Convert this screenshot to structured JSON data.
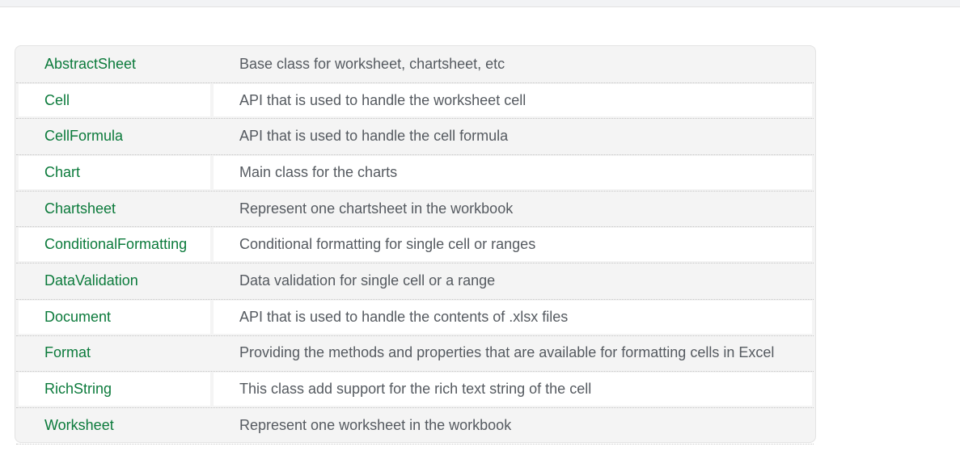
{
  "classes": [
    {
      "name": "AbstractSheet",
      "description": "Base class for worksheet, chartsheet, etc"
    },
    {
      "name": "Cell",
      "description": "API that is used to handle the worksheet cell"
    },
    {
      "name": "CellFormula",
      "description": "API that is used to handle the cell formula"
    },
    {
      "name": "Chart",
      "description": "Main class for the charts"
    },
    {
      "name": "Chartsheet",
      "description": "Represent one chartsheet in the workbook"
    },
    {
      "name": "ConditionalFormatting",
      "description": "Conditional formatting for single cell or ranges"
    },
    {
      "name": "DataValidation",
      "description": "Data validation for single cell or a range"
    },
    {
      "name": "Document",
      "description": "API that is used to handle the contents of .xlsx files"
    },
    {
      "name": "Format",
      "description": "Providing the methods and properties that are available for formatting cells in Excel"
    },
    {
      "name": "RichString",
      "description": "This class add support for the rich text string of the cell"
    },
    {
      "name": "Worksheet",
      "description": "Represent one worksheet in the workbook"
    }
  ],
  "colors": {
    "link": "#0b7a3b",
    "text": "#555a60",
    "stripe": "#f4f4f4"
  }
}
